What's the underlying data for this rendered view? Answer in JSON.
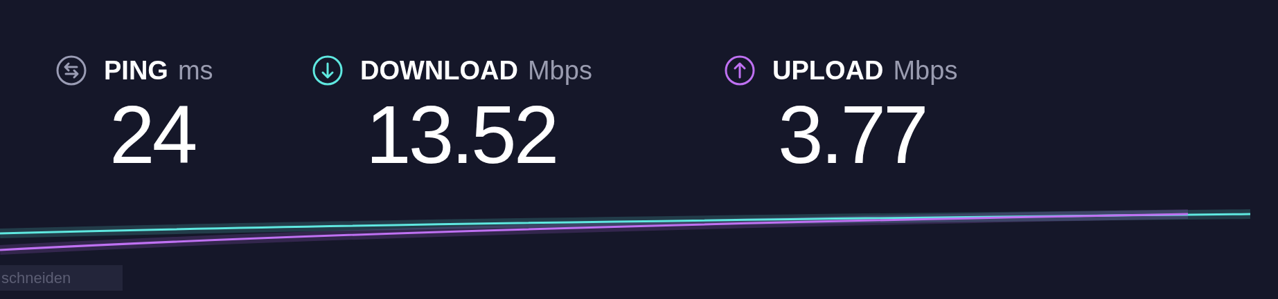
{
  "metrics": [
    {
      "kind": "ping",
      "label": "PING",
      "unit": "ms",
      "value": "24",
      "color": "#9a9cb4"
    },
    {
      "kind": "download",
      "label": "DOWNLOAD",
      "unit": "Mbps",
      "value": "13.52",
      "color": "#5fe8e0"
    },
    {
      "kind": "upload",
      "label": "UPLOAD",
      "unit": "Mbps",
      "value": "3.77",
      "color": "#bf71f2"
    }
  ],
  "tooltip": {
    "text": "schneiden"
  }
}
